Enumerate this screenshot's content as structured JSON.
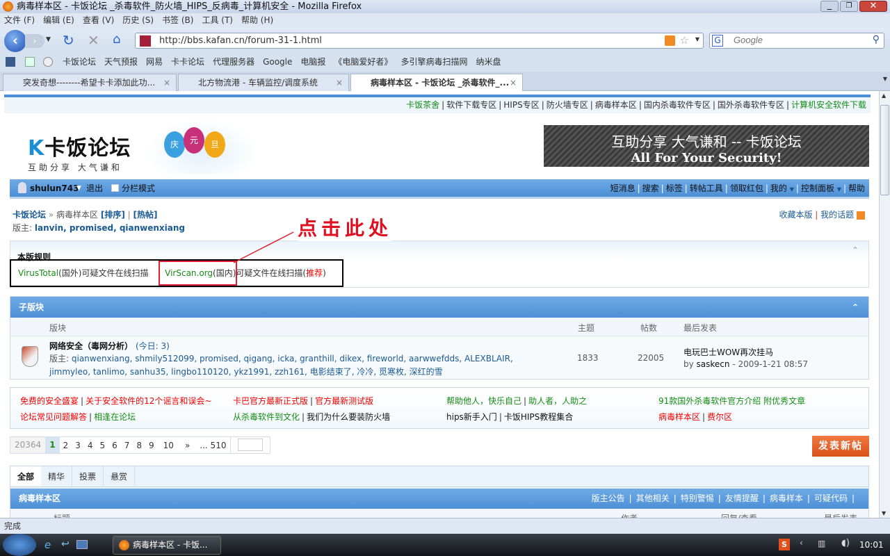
{
  "window": {
    "title": "病毒样本区 - 卡饭论坛 _杀毒软件_防火墙_HIPS_反病毒_计算机安全 - Mozilla Firefox"
  },
  "menu": [
    "文件 (F)",
    "编辑 (E)",
    "查看 (V)",
    "历史 (S)",
    "书签 (B)",
    "工具 (T)",
    "帮助 (H)"
  ],
  "url": "http://bbs.kafan.cn/forum-31-1.html",
  "search_placeholder": "Google",
  "bookmarks": [
    "卡饭论坛",
    "天气预报",
    "网易",
    "卡卡论坛",
    "代理服务器",
    "Google",
    "电脑报",
    "《电脑爱好者》",
    "多引擎病毒扫描网",
    "纳米盘"
  ],
  "tabs": [
    {
      "label": "突发奇想--------希望卡卡添加此功...",
      "active": false
    },
    {
      "label": "北方物流港 - 车辆监控/调度系统",
      "active": false
    },
    {
      "label": "病毒样本区 - 卡饭论坛 _杀毒软件_...",
      "active": true
    }
  ],
  "topnav": [
    "卡饭茶舍",
    "软件下载专区",
    "HIPS专区",
    "防火墙专区",
    "病毒样本区",
    "国内杀毒软件专区",
    "国外杀毒软件专区",
    "计算机安全软件下载"
  ],
  "logo": {
    "name": "卡饭论坛",
    "slogan": "互助分享  大气谦和",
    "balloons": [
      "庆",
      "元",
      "旦"
    ]
  },
  "banner": {
    "line1": "互助分享 大气谦和 -- 卡饭论坛",
    "line2": "All For Your Security!"
  },
  "userbar": {
    "username": "shulun743",
    "logout": "退出",
    "split_mode": "分栏模式",
    "links": [
      "短消息",
      "搜索",
      "标签",
      "转帖工具",
      "领取红包",
      "我的",
      "控制面板",
      "帮助"
    ]
  },
  "breadcrumb": {
    "home": "卡饭论坛",
    "current": "病毒样本区",
    "sort": "[排序]",
    "hot": "[热帖]",
    "moderator_label": "版主:",
    "moderators": "lanvin, promised, qianwenxiang",
    "fav": "收藏本版",
    "my_topics": "我的话题"
  },
  "annotation": "点击此处",
  "rules": {
    "title": "本版规则",
    "vt": "VirusTotal",
    "vt_text": "(国外)可疑文件在线扫描",
    "vs": "VirScan.org",
    "vs_text1": "(国内)可疑文件在线扫描(",
    "vs_rec": "推荐",
    "vs_text2": ")"
  },
  "subforums": {
    "title": "子版块",
    "cols": [
      "版块",
      "主题",
      "帖数",
      "最后发表"
    ],
    "row": {
      "name": "网络安全（毒网分析）",
      "today": "(今日: 3)",
      "mods_label": "版主:",
      "mods": "qianwenxiang, shmily512099, promised, qigang, icka, granthill, dikex, fireworld, aarwwefdds, ALEXBLAIR, jimmyleo, tanlimo, sanhu35, lingbo110120, ykz1991, zzh161, 电影结束了, 冷冷, 觅寒枚, 深红的雪",
      "topics": "1833",
      "posts": "22005",
      "last_title": "电玩巴士WOW再次挂马",
      "last_by": "by",
      "last_user": "saskecn",
      "last_time": "- 2009-1-21 08:57"
    }
  },
  "links": [
    [
      "免费的安全盛宴",
      "关于安全软件的12个谣言和误会~"
    ],
    [
      "卡巴官方最新正式版",
      "官方最新测试版"
    ],
    [
      "帮助他人，快乐自己",
      "助人者，人助之"
    ],
    [
      "91款国外杀毒软件官方介绍 附优秀文章"
    ],
    [
      "论坛常见问题解答",
      "相逢在论坛"
    ],
    [
      "从杀毒软件到文化",
      "我们为什么要装防火墙"
    ],
    [
      "hips新手入门",
      "卡饭HIPS教程集合"
    ],
    [
      "病毒样本区",
      "费尔区"
    ]
  ],
  "pagination": {
    "total": "20364",
    "current": "1",
    "pages": [
      "2",
      "3",
      "4",
      "5",
      "6",
      "7",
      "8",
      "9",
      "10"
    ],
    "next": "»",
    "last": "... 510"
  },
  "post_button": "发表新帖",
  "thread_tabs": [
    "全部",
    "精华",
    "投票",
    "悬赏"
  ],
  "forum_header": {
    "title": "病毒样本区",
    "links": [
      "版主公告",
      "其他相关",
      "特别警惕",
      "友情提醒",
      "病毒样本",
      "可疑代码"
    ]
  },
  "thread_cols": [
    "标题",
    "作者",
    "回复/查看",
    "最后发表"
  ],
  "status": "完成",
  "taskbar": {
    "window": "病毒样本区 - 卡饭...",
    "clock": "10:01"
  }
}
